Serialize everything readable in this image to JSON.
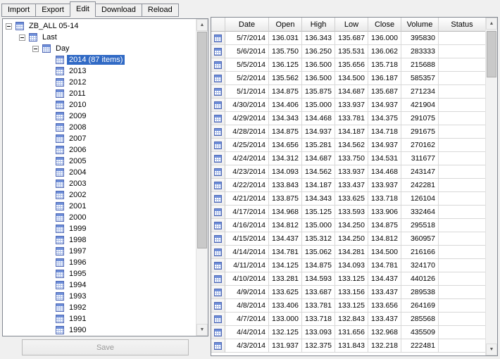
{
  "tabs": {
    "items": [
      {
        "label": "Import",
        "active": false
      },
      {
        "label": "Export",
        "active": false
      },
      {
        "label": "Edit",
        "active": true
      },
      {
        "label": "Download",
        "active": false
      },
      {
        "label": "Reload",
        "active": false
      }
    ]
  },
  "tree": {
    "items": [
      {
        "label": "ZB_ALL 05-14",
        "depth": 0,
        "expander": true,
        "selected": false
      },
      {
        "label": "Last",
        "depth": 1,
        "expander": true,
        "selected": false
      },
      {
        "label": "Day",
        "depth": 2,
        "expander": true,
        "selected": false
      },
      {
        "label": "2014 (87 items)",
        "depth": 3,
        "expander": false,
        "selected": true
      },
      {
        "label": "2013",
        "depth": 3,
        "expander": false,
        "selected": false
      },
      {
        "label": "2012",
        "depth": 3,
        "expander": false,
        "selected": false
      },
      {
        "label": "2011",
        "depth": 3,
        "expander": false,
        "selected": false
      },
      {
        "label": "2010",
        "depth": 3,
        "expander": false,
        "selected": false
      },
      {
        "label": "2009",
        "depth": 3,
        "expander": false,
        "selected": false
      },
      {
        "label": "2008",
        "depth": 3,
        "expander": false,
        "selected": false
      },
      {
        "label": "2007",
        "depth": 3,
        "expander": false,
        "selected": false
      },
      {
        "label": "2006",
        "depth": 3,
        "expander": false,
        "selected": false
      },
      {
        "label": "2005",
        "depth": 3,
        "expander": false,
        "selected": false
      },
      {
        "label": "2004",
        "depth": 3,
        "expander": false,
        "selected": false
      },
      {
        "label": "2003",
        "depth": 3,
        "expander": false,
        "selected": false
      },
      {
        "label": "2002",
        "depth": 3,
        "expander": false,
        "selected": false
      },
      {
        "label": "2001",
        "depth": 3,
        "expander": false,
        "selected": false
      },
      {
        "label": "2000",
        "depth": 3,
        "expander": false,
        "selected": false
      },
      {
        "label": "1999",
        "depth": 3,
        "expander": false,
        "selected": false
      },
      {
        "label": "1998",
        "depth": 3,
        "expander": false,
        "selected": false
      },
      {
        "label": "1997",
        "depth": 3,
        "expander": false,
        "selected": false
      },
      {
        "label": "1996",
        "depth": 3,
        "expander": false,
        "selected": false
      },
      {
        "label": "1995",
        "depth": 3,
        "expander": false,
        "selected": false
      },
      {
        "label": "1994",
        "depth": 3,
        "expander": false,
        "selected": false
      },
      {
        "label": "1993",
        "depth": 3,
        "expander": false,
        "selected": false
      },
      {
        "label": "1992",
        "depth": 3,
        "expander": false,
        "selected": false
      },
      {
        "label": "1991",
        "depth": 3,
        "expander": false,
        "selected": false
      },
      {
        "label": "1990",
        "depth": 3,
        "expander": false,
        "selected": false
      }
    ]
  },
  "save_button": {
    "label": "Save",
    "enabled": false
  },
  "grid": {
    "columns": [
      "Date",
      "Open",
      "High",
      "Low",
      "Close",
      "Volume",
      "Status"
    ],
    "rows": [
      [
        "5/7/2014",
        "136.031",
        "136.343",
        "135.687",
        "136.000",
        "395830",
        ""
      ],
      [
        "5/6/2014",
        "135.750",
        "136.250",
        "135.531",
        "136.062",
        "283333",
        ""
      ],
      [
        "5/5/2014",
        "136.125",
        "136.500",
        "135.656",
        "135.718",
        "215688",
        ""
      ],
      [
        "5/2/2014",
        "135.562",
        "136.500",
        "134.500",
        "136.187",
        "585357",
        ""
      ],
      [
        "5/1/2014",
        "134.875",
        "135.875",
        "134.687",
        "135.687",
        "271234",
        ""
      ],
      [
        "4/30/2014",
        "134.406",
        "135.000",
        "133.937",
        "134.937",
        "421904",
        ""
      ],
      [
        "4/29/2014",
        "134.343",
        "134.468",
        "133.781",
        "134.375",
        "291075",
        ""
      ],
      [
        "4/28/2014",
        "134.875",
        "134.937",
        "134.187",
        "134.718",
        "291675",
        ""
      ],
      [
        "4/25/2014",
        "134.656",
        "135.281",
        "134.562",
        "134.937",
        "270162",
        ""
      ],
      [
        "4/24/2014",
        "134.312",
        "134.687",
        "133.750",
        "134.531",
        "311677",
        ""
      ],
      [
        "4/23/2014",
        "134.093",
        "134.562",
        "133.937",
        "134.468",
        "243147",
        ""
      ],
      [
        "4/22/2014",
        "133.843",
        "134.187",
        "133.437",
        "133.937",
        "242281",
        ""
      ],
      [
        "4/21/2014",
        "133.875",
        "134.343",
        "133.625",
        "133.718",
        "126104",
        ""
      ],
      [
        "4/17/2014",
        "134.968",
        "135.125",
        "133.593",
        "133.906",
        "332464",
        ""
      ],
      [
        "4/16/2014",
        "134.812",
        "135.000",
        "134.250",
        "134.875",
        "295518",
        ""
      ],
      [
        "4/15/2014",
        "134.437",
        "135.312",
        "134.250",
        "134.812",
        "360957",
        ""
      ],
      [
        "4/14/2014",
        "134.781",
        "135.062",
        "134.281",
        "134.500",
        "216166",
        ""
      ],
      [
        "4/11/2014",
        "134.125",
        "134.875",
        "134.093",
        "134.781",
        "324170",
        ""
      ],
      [
        "4/10/2014",
        "133.281",
        "134.593",
        "133.125",
        "134.437",
        "440126",
        ""
      ],
      [
        "4/9/2014",
        "133.625",
        "133.687",
        "133.156",
        "133.437",
        "289538",
        ""
      ],
      [
        "4/8/2014",
        "133.406",
        "133.781",
        "133.125",
        "133.656",
        "264169",
        ""
      ],
      [
        "4/7/2014",
        "133.000",
        "133.718",
        "132.843",
        "133.437",
        "285568",
        ""
      ],
      [
        "4/4/2014",
        "132.125",
        "133.093",
        "131.656",
        "132.968",
        "435509",
        ""
      ],
      [
        "4/3/2014",
        "131.937",
        "132.375",
        "131.843",
        "132.218",
        "222481",
        ""
      ]
    ]
  },
  "icons": {
    "scroll_up": "▲",
    "scroll_down": "▼"
  },
  "colors": {
    "tree_selection": "#316AC5",
    "tree_selection_text": "#FFFFFF"
  }
}
